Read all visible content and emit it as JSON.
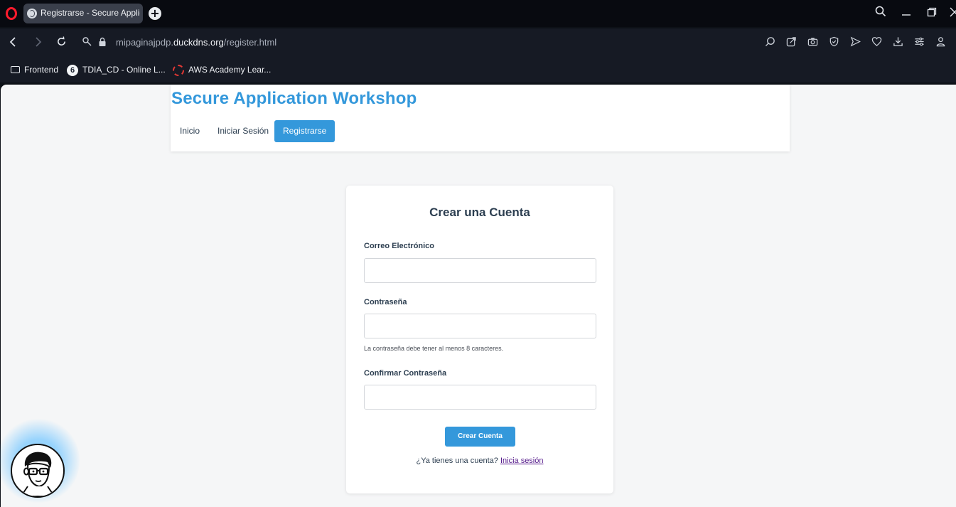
{
  "browser": {
    "tab_title": "Registrarse - Secure Applic",
    "url_prefix": "mipaginajpdp.",
    "url_domain": "duckdns.org",
    "url_path": "/register.html",
    "bookmarks": [
      {
        "label": "Frontend",
        "icon": "folder-icon"
      },
      {
        "label": "TDIA_CD - Online L...",
        "icon": "tdia-icon"
      },
      {
        "label": "AWS Academy Lear...",
        "icon": "aws-icon"
      }
    ]
  },
  "site": {
    "title": "Secure Application Workshop",
    "nav": [
      {
        "label": "Inicio"
      },
      {
        "label": "Iniciar Sesión"
      },
      {
        "label": "Registrarse",
        "active": true
      }
    ]
  },
  "form": {
    "heading": "Crear una Cuenta",
    "email_label": "Correo Electrónico",
    "email_value": "",
    "password_label": "Contraseña",
    "password_value": "",
    "password_hint": "La contraseña debe tener al menos 8 caracteres.",
    "confirm_label": "Confirmar Contraseña",
    "confirm_value": "",
    "submit_label": "Crear Cuenta",
    "login_prompt": "¿Ya tienes una cuenta?",
    "login_link": "Inicia sesión"
  },
  "colors": {
    "accent": "#3498db",
    "heading_text": "#2c3e50",
    "link_visited": "#551a8b",
    "page_bg": "#f5f6f7"
  }
}
